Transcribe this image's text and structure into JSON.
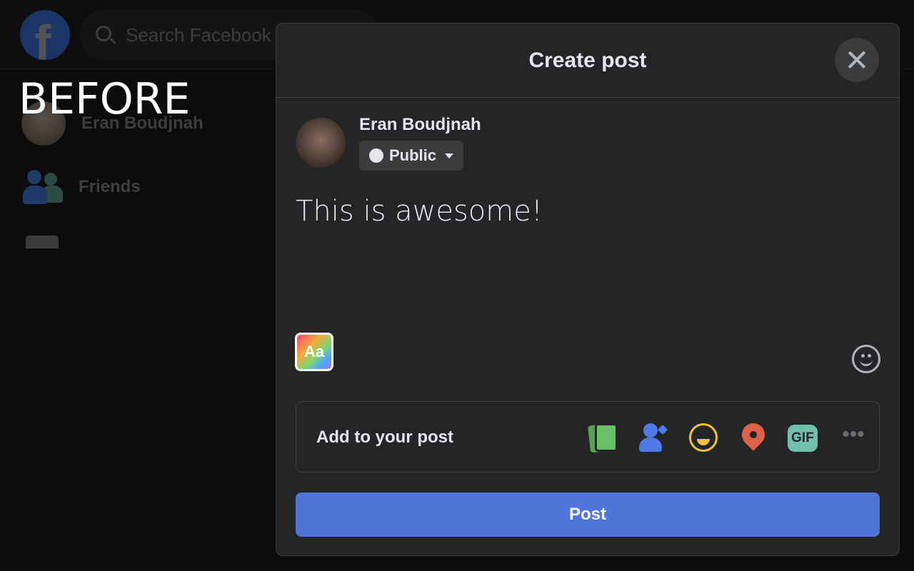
{
  "overlay_label": "BEFORE",
  "header": {
    "logo": "f",
    "search_placeholder": "Search Facebook"
  },
  "sidebar": {
    "items": [
      {
        "label": "Eran Boudjnah",
        "icon": "avatar"
      },
      {
        "label": "Friends",
        "icon": "friends-icon"
      }
    ]
  },
  "modal": {
    "title": "Create post",
    "user_name": "Eran Boudjnah",
    "audience": "Public",
    "post_text": "This is awesome!",
    "text_style_label": "Aa",
    "add_to_post_label": "Add to your post",
    "add_icons": [
      {
        "name": "photo-video",
        "color": "#6abf69"
      },
      {
        "name": "tag-people",
        "color": "#4e7be8"
      },
      {
        "name": "feeling-activity",
        "color": "#f0c43a"
      },
      {
        "name": "check-in",
        "color": "#e0604a"
      },
      {
        "name": "gif",
        "color": "#6fbfaa",
        "label": "GIF"
      },
      {
        "name": "more",
        "color": "#6a6c70"
      }
    ],
    "post_button": "Post"
  },
  "colors": {
    "accent": "#4f75d8",
    "background": "#242527"
  }
}
